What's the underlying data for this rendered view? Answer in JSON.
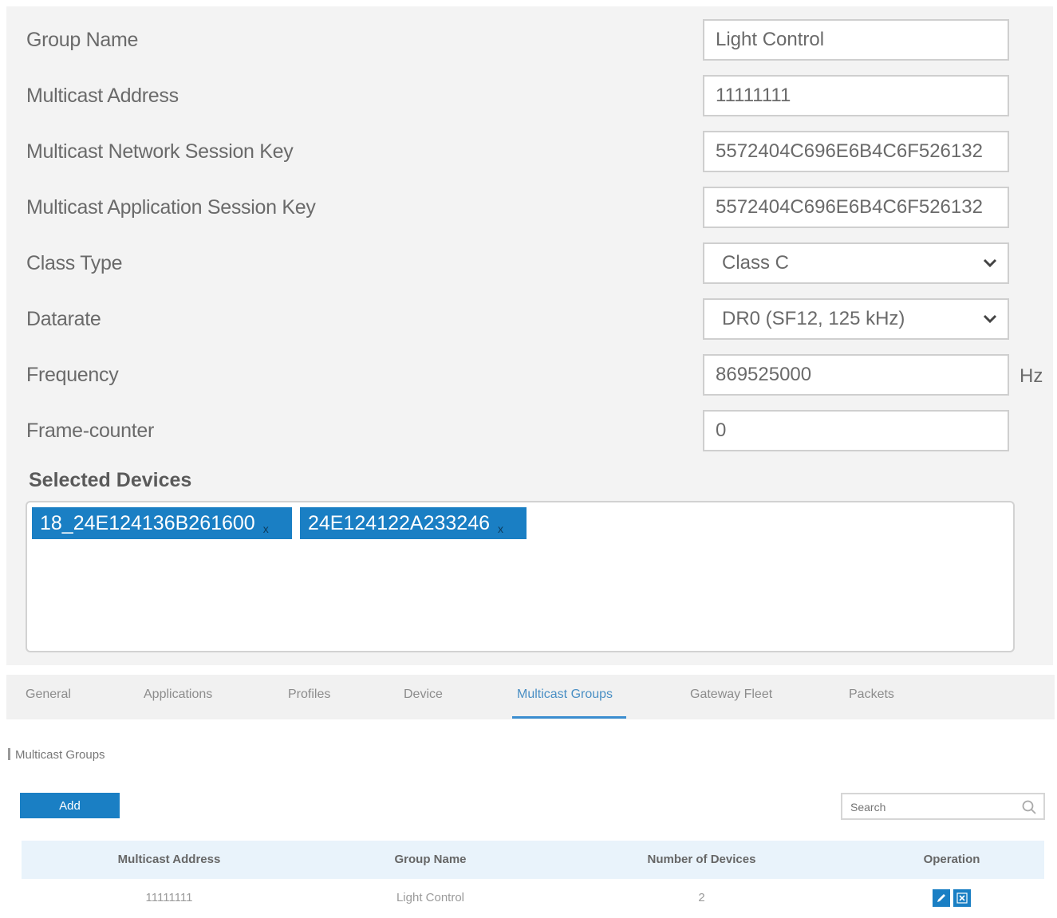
{
  "form": {
    "group_name": {
      "label": "Group Name",
      "value": "Light Control"
    },
    "multicast_address": {
      "label": "Multicast Address",
      "value": "11111111"
    },
    "network_session_key": {
      "label": "Multicast Network Session Key",
      "value": "5572404C696E6B4C6F526132"
    },
    "application_session_key": {
      "label": "Multicast Application Session Key",
      "value": "5572404C696E6B4C6F526132"
    },
    "class_type": {
      "label": "Class Type",
      "value": "Class C"
    },
    "datarate": {
      "label": "Datarate",
      "value": "DR0 (SF12, 125 kHz)"
    },
    "frequency": {
      "label": "Frequency",
      "value": "869525000",
      "unit": "Hz"
    },
    "frame_counter": {
      "label": "Frame-counter",
      "value": "0"
    }
  },
  "selected_devices": {
    "title": "Selected Devices",
    "items": [
      {
        "label": "18_24E124136B261600",
        "remove": "x"
      },
      {
        "label": "24E124122A233246",
        "remove": "x"
      }
    ]
  },
  "tabs": [
    {
      "label": "General"
    },
    {
      "label": "Applications"
    },
    {
      "label": "Profiles"
    },
    {
      "label": "Device"
    },
    {
      "label": "Multicast Groups"
    },
    {
      "label": "Gateway Fleet"
    },
    {
      "label": "Packets"
    }
  ],
  "active_tab": "Multicast Groups",
  "section": {
    "title": "Multicast Groups",
    "add_label": "Add",
    "search_placeholder": "Search"
  },
  "table": {
    "columns": [
      "Multicast Address",
      "Group Name",
      "Number of Devices",
      "Operation"
    ],
    "rows": [
      {
        "multicast_address": "11111111",
        "group_name": "Light Control",
        "number_of_devices": "2"
      }
    ]
  },
  "colors": {
    "accent": "#1a7fc4",
    "tab_active": "#4a8fc4",
    "table_header_bg": "#e9f3fb"
  }
}
